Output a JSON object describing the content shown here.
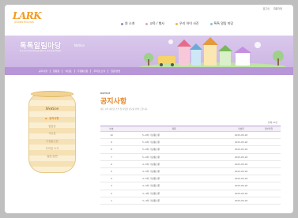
{
  "brand": {
    "logo": "LARK",
    "tagline": "CHILDREN EDUCATION"
  },
  "util": [
    "로그인",
    "회원가입"
  ],
  "gnb": [
    {
      "label": "원 소개"
    },
    {
      "label": "교육 / 행사"
    },
    {
      "label": "우리 아이 사진"
    },
    {
      "label": "톡톡 알림 마당"
    }
  ],
  "banner": {
    "title": "톡톡알림마당",
    "title_en": "Notice",
    "desc": "원 소식과 다양한 이야기를 전합니다. 관심 있게 봐주세요."
  },
  "subnav": [
    "공지사항",
    "알림장",
    "식단표",
    "가정통신문",
    "우리집 소식",
    "질문/답변"
  ],
  "side": {
    "title": "Notice",
    "items": [
      {
        "label": "공지사항",
        "active": true
      },
      {
        "label": "알림장"
      },
      {
        "label": "식단표"
      },
      {
        "label": "가정통신문"
      },
      {
        "label": "우리집 소식"
      },
      {
        "label": "질문/답변"
      }
    ]
  },
  "main": {
    "label": "NOTICE",
    "title": "공지사항",
    "desc": "새로 시작 새로운 소식 및 다양한 정보를 전해 드립니다.",
    "total": "전체 10건",
    "columns": [
      "번호",
      "제목",
      "작성일",
      "첨부파일"
    ],
    "rows": [
      {
        "no": "10",
        "title": "5~6차 가정통신문",
        "date": "2015-05-18"
      },
      {
        "no": "9",
        "title": "5~6차 가정통신문",
        "date": "2015-05-18"
      },
      {
        "no": "8",
        "title": "5~6차 가정통신문",
        "date": "2015-05-18"
      },
      {
        "no": "7",
        "title": "5~6차 가정통신문",
        "date": "2015-05-18"
      },
      {
        "no": "6",
        "title": "4~5차 가정통신문",
        "date": "2015-05-18"
      },
      {
        "no": "5",
        "title": "4~5차 가정통신문",
        "date": "2015-05-18"
      },
      {
        "no": "4",
        "title": "4~5차 가정통신문",
        "date": "2015-05-18"
      },
      {
        "no": "3",
        "title": "4~5차 가정통신문",
        "date": "2015-05-18"
      },
      {
        "no": "2",
        "title": "3~4차 가정통신문",
        "date": "2015-05-18"
      },
      {
        "no": "1",
        "title": "3~4차 가정통신문",
        "date": "2015-05-18"
      }
    ]
  },
  "colors": {
    "accent": "#e8892a",
    "purple": "#b796d7",
    "banner": "#d5c0ea"
  }
}
